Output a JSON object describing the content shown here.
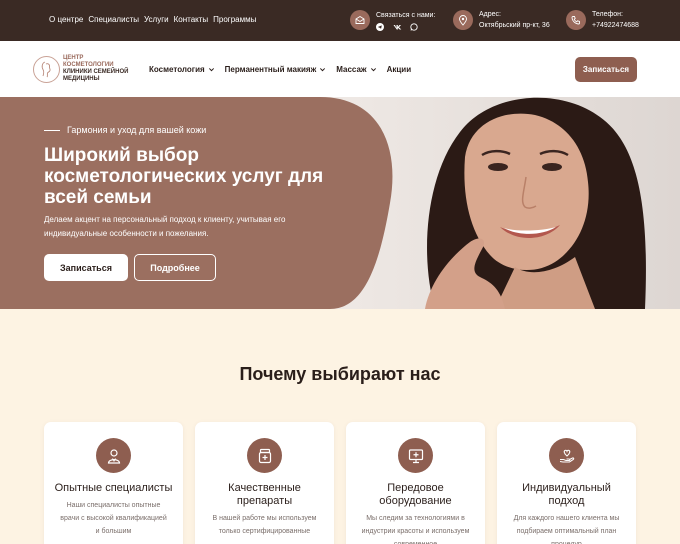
{
  "topbar": {
    "nav": [
      "О центре",
      "Специалисты",
      "Услуги",
      "Контакты",
      "Программы"
    ],
    "contact_label": "Связаться с нами:",
    "address_label": "Адрес:",
    "address_value": "Октябрьский пр-кт, 36",
    "phone_label": "Телефон:",
    "phone_value": "+74922474688",
    "socials": [
      "telegram-icon",
      "vk-icon",
      "whatsapp-icon"
    ]
  },
  "header": {
    "logo_line1": "ЦЕНТР КОСМЕТОЛОГИИ",
    "logo_line2": "КЛИНИКИ СЕМЕЙНОЙ МЕДИЦИНЫ",
    "nav": [
      {
        "label": "Косметология",
        "dropdown": true
      },
      {
        "label": "Перманентный макияж",
        "dropdown": true
      },
      {
        "label": "Массаж",
        "dropdown": true
      },
      {
        "label": "Акции",
        "dropdown": false
      }
    ],
    "cta": "Записаться"
  },
  "hero": {
    "eyebrow": "Гармония и уход для вашей кожи",
    "title": "Широкий выбор косметологических услуг для всей семьи",
    "description": "Делаем акцент на персональный подход к клиенту, учитывая его индивидуальные особенности и пожелания.",
    "primary_button": "Записаться",
    "secondary_button": "Подробнее"
  },
  "why": {
    "title": "Почему выбирают нас",
    "cards": [
      {
        "icon": "specialist-icon",
        "title": "Опытные специалисты",
        "text": "Наши специалисты опытные врачи с высокой квалификацией и большим"
      },
      {
        "icon": "jar-icon",
        "title": "Качественные препараты",
        "text": "В нашей работе мы используем только сертифицированные"
      },
      {
        "icon": "monitor-plus-icon",
        "title": "Передовое оборудование",
        "text": "Мы следим за технологиями в индустрии красоты и используем современное"
      },
      {
        "icon": "hand-heart-icon",
        "title": "Индивидуальный подход",
        "text": "Для каждого нашего клиента мы подбираем оптимальный план процедур"
      }
    ]
  },
  "colors": {
    "topbar": "#3a2a24",
    "accent": "#8e5e50",
    "hero_panel": "#9b6f60",
    "background": "#fdf3e3"
  }
}
